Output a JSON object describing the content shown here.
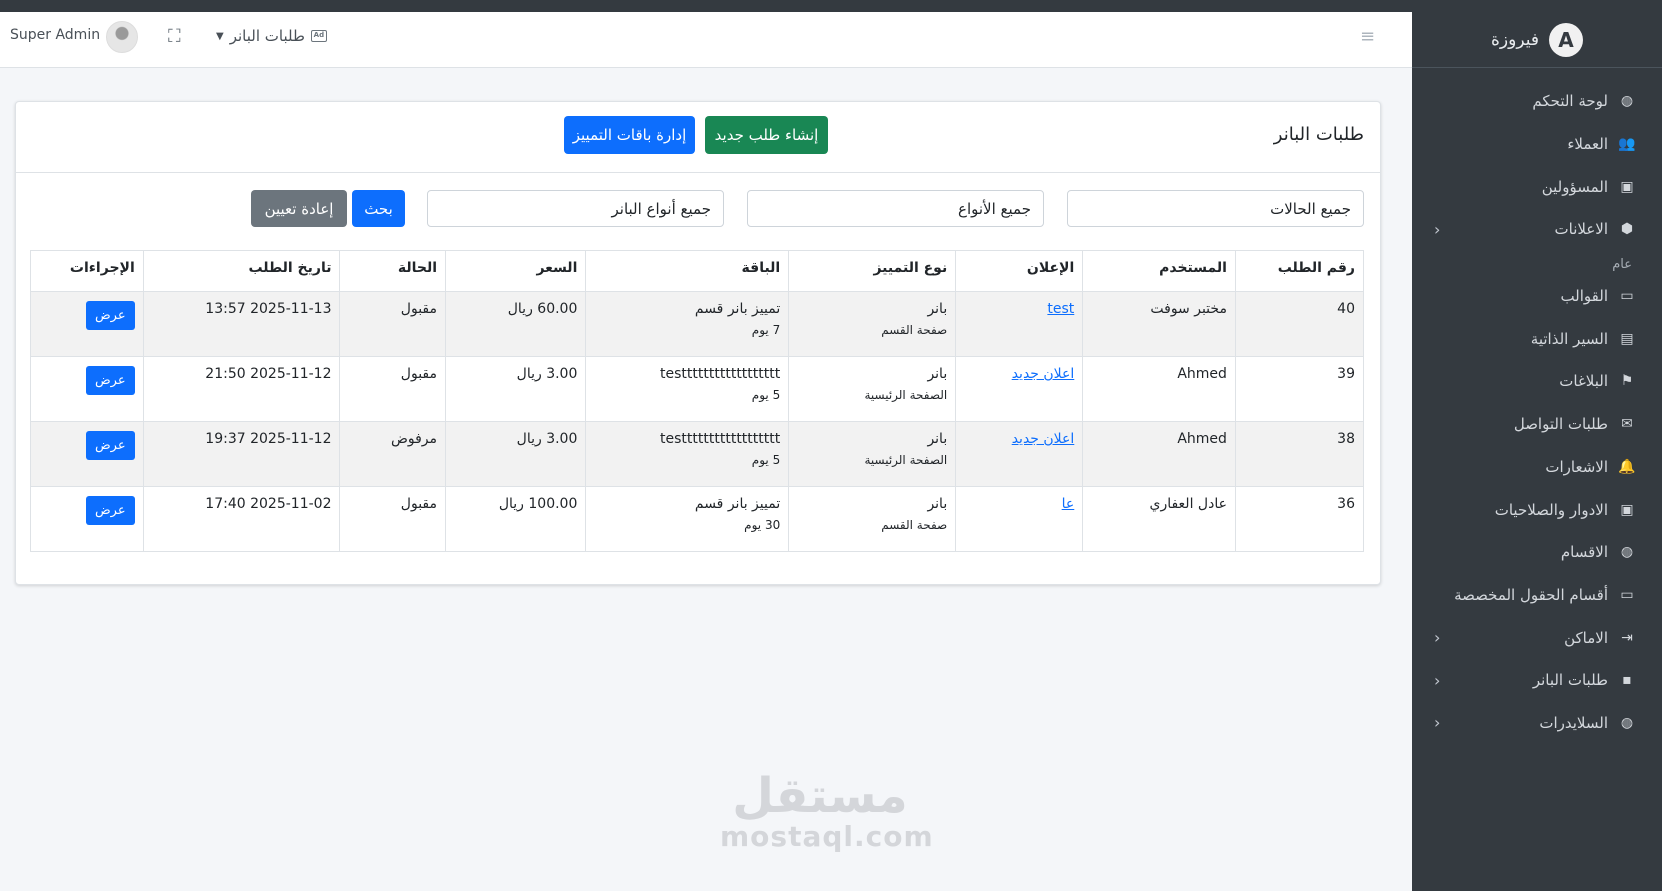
{
  "navbar": {
    "user_name": "Super Admin",
    "page_menu_label": "طلبات البانر",
    "ad_icon_text": "Ad"
  },
  "sidebar": {
    "brand_letter": "A",
    "brand_name": "فيروزة",
    "section_header": "عام",
    "items": [
      {
        "label": "لوحة التحكم",
        "icon": "palette-icon",
        "glyph": "◍",
        "has_chevron": false
      },
      {
        "label": "العملاء",
        "icon": "users-icon",
        "glyph": "👥",
        "has_chevron": false
      },
      {
        "label": "المسؤولين",
        "icon": "id-card-icon",
        "glyph": "▣",
        "has_chevron": false
      },
      {
        "label": "الاعلانات",
        "icon": "box-icon",
        "glyph": "⬢",
        "has_chevron": true
      },
      {
        "label": "القوالب",
        "icon": "folder-icon",
        "glyph": "▭",
        "has_chevron": false
      },
      {
        "label": "السير الذاتية",
        "icon": "person-badge-icon",
        "glyph": "▤",
        "has_chevron": false
      },
      {
        "label": "البلاغات",
        "icon": "flag-icon",
        "glyph": "⚑",
        "has_chevron": false
      },
      {
        "label": "طلبات التواصل",
        "icon": "envelope-icon",
        "glyph": "✉",
        "has_chevron": false
      },
      {
        "label": "الاشعارات",
        "icon": "bell-icon",
        "glyph": "🔔",
        "has_chevron": false
      },
      {
        "label": "الادوار والصلاحيات",
        "icon": "id-card-icon",
        "glyph": "▣",
        "has_chevron": false
      },
      {
        "label": "الاقسام",
        "icon": "palette-icon",
        "glyph": "◍",
        "has_chevron": false
      },
      {
        "label": "أقسام الحقول المخصصة",
        "icon": "folder-plus-icon",
        "glyph": "▭",
        "has_chevron": false
      },
      {
        "label": "الاماكن",
        "icon": "box-arrow-in-icon",
        "glyph": "⇥",
        "has_chevron": true
      },
      {
        "label": "طلبات البانر",
        "icon": "ad-icon",
        "glyph": "▪",
        "has_chevron": true
      },
      {
        "label": "السلايدرات",
        "icon": "palette-icon",
        "glyph": "◍",
        "has_chevron": true
      }
    ]
  },
  "card": {
    "title": "طلبات البانر",
    "create_button": "إنشاء طلب جديد",
    "manage_button": "إدارة باقات التمييز",
    "filters": {
      "status": "جميع الحالات",
      "types": "جميع الأنواع",
      "banner_types": "جميع أنواع البانر",
      "search_button": "بحث",
      "reset_button": "إعادة تعيين"
    }
  },
  "table": {
    "headers": [
      "رقم الطلب",
      "المستخدم",
      "الإعلان",
      "نوع التمييز",
      "الباقة",
      "السعر",
      "الحالة",
      "تاريخ الطلب",
      "الإجراءات"
    ],
    "rows": [
      {
        "id": "40",
        "user": "مختبر سوفت",
        "ad": "test",
        "type": "بانر",
        "type_sub": "صفحة القسم",
        "package": "تمييز بانر قسم",
        "package_sub": "7 يوم",
        "price": "60.00 ريال",
        "status": "مقبول",
        "date": "2025-11-13 13:57",
        "action": "عرض"
      },
      {
        "id": "39",
        "user": "Ahmed",
        "ad": "اعلان جديد",
        "type": "بانر",
        "type_sub": "الصفحة الرئيسية",
        "package": "testttttttttttttttttt",
        "package_sub": "5 يوم",
        "price": "3.00 ريال",
        "status": "مقبول",
        "date": "2025-11-12 21:50",
        "action": "عرض"
      },
      {
        "id": "38",
        "user": "Ahmed",
        "ad": "اعلان جديد",
        "type": "بانر",
        "type_sub": "الصفحة الرئيسية",
        "package": "testttttttttttttttttt",
        "package_sub": "5 يوم",
        "price": "3.00 ريال",
        "status": "مرفوض",
        "date": "2025-11-12 19:37",
        "action": "عرض"
      },
      {
        "id": "36",
        "user": "عادل العفاري",
        "ad": "عا",
        "type": "بانر",
        "type_sub": "صفحة القسم",
        "package": "تمييز بانر قسم",
        "package_sub": "30 يوم",
        "price": "100.00 ريال",
        "status": "مقبول",
        "date": "2025-11-02 17:40",
        "action": "عرض"
      }
    ]
  },
  "watermark": {
    "arabic": "مستقل",
    "latin": "mostaql.com"
  },
  "colors": {
    "sidebar_bg": "#343a40",
    "primary": "#0d6efd",
    "success": "#198754",
    "secondary": "#6c757d"
  }
}
